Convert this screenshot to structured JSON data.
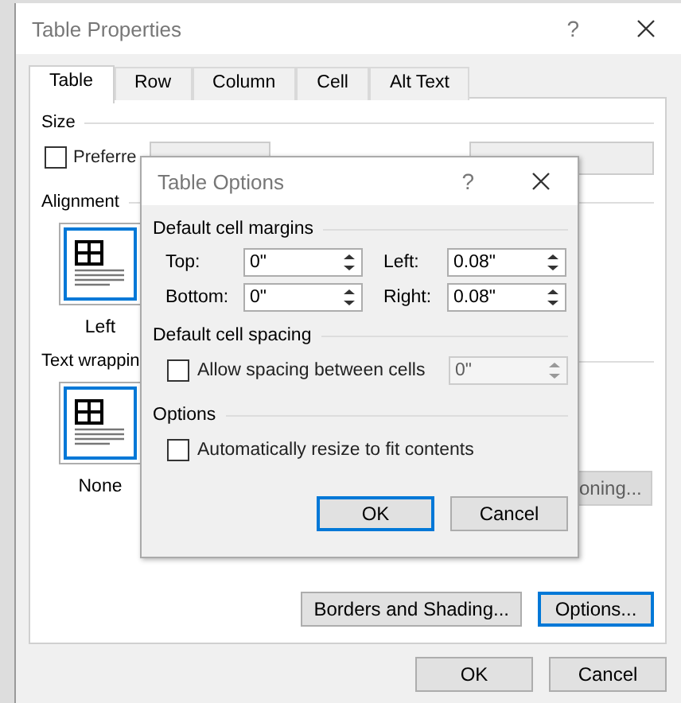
{
  "window": {
    "title": "Table Properties",
    "help": "?"
  },
  "tabs": [
    {
      "label": "Table",
      "selected": true
    },
    {
      "label": "Row",
      "selected": false
    },
    {
      "label": "Column",
      "selected": false
    },
    {
      "label": "Cell",
      "selected": false
    },
    {
      "label": "Alt Text",
      "selected": false
    }
  ],
  "size": {
    "heading": "Size",
    "preferred_width": {
      "label": "Preferre",
      "checked": false
    }
  },
  "alignment": {
    "heading": "Alignment",
    "options": [
      {
        "label": "Left",
        "selected": true
      }
    ]
  },
  "text_wrapping": {
    "heading": "Text wrappin",
    "options": [
      {
        "label": "None",
        "selected": true
      }
    ]
  },
  "positioning_button": {
    "label": "oning...",
    "disabled": true
  },
  "panel_buttons": [
    {
      "label": "Borders and Shading...",
      "default": false
    },
    {
      "label": "Options...",
      "default": true
    }
  ],
  "buttons": [
    {
      "label": "OK",
      "default": false
    },
    {
      "label": "Cancel",
      "default": false
    }
  ],
  "table_options": {
    "title": "Table Options",
    "help": "?",
    "margins": {
      "heading": "Default cell margins",
      "fields": [
        {
          "label": "Top:",
          "value": "0\""
        },
        {
          "label": "Left:",
          "value": "0.08\""
        },
        {
          "label": "Bottom:",
          "value": "0\""
        },
        {
          "label": "Right:",
          "value": "0.08\""
        }
      ]
    },
    "spacing": {
      "heading": "Default cell spacing",
      "label": "Allow spacing between cells",
      "checked": false,
      "value": "0\"",
      "disabled": true
    },
    "options": {
      "heading": "Options",
      "label": "Automatically resize to fit contents",
      "checked": false
    },
    "buttons": [
      {
        "label": "OK",
        "default": true
      },
      {
        "label": "Cancel",
        "default": false
      }
    ]
  }
}
